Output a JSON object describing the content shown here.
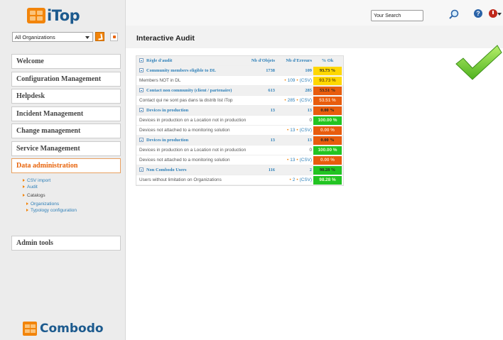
{
  "sidebar": {
    "logo_text": "iTop",
    "organization_select": "All Organizations",
    "menus": [
      {
        "label": "Welcome"
      },
      {
        "label": "Configuration Management"
      },
      {
        "label": "Helpdesk"
      },
      {
        "label": "Incident Management"
      },
      {
        "label": "Change management"
      },
      {
        "label": "Service Management"
      },
      {
        "label": "Data administration"
      },
      {
        "label": "Admin tools"
      }
    ],
    "submenu": {
      "csv_import": "CSV import",
      "audit": "Audit",
      "catalogs": "Catalogs",
      "organizations": "Organizations",
      "typology": "Typology configuration"
    },
    "footer_logo": "Combodo"
  },
  "topbar": {
    "search_value": "Your Search",
    "icons": [
      "search-icon",
      "help-icon",
      "logoff-icon"
    ]
  },
  "page": {
    "title": "Interactive Audit"
  },
  "audit": {
    "headers": [
      "Règle d'audit",
      "Nb d'Objets",
      "Nb d'Erreurs",
      "% Ok"
    ],
    "rows": [
      {
        "type": "rule",
        "label": "Community members eligible to DL",
        "objects": "1738",
        "errors": "109",
        "pct": "93.73 %",
        "color": "#ffd700"
      },
      {
        "type": "query",
        "label": "Members NOT in DL",
        "objects": "",
        "errors": "109",
        "csv": "(CSV)",
        "pct": "93.73 %",
        "color": "#ffd700"
      },
      {
        "type": "rule",
        "label": "Contact non community (client / partenaire)",
        "objects": "613",
        "errors": "285",
        "pct": "53.51 %",
        "color": "#e85c0d"
      },
      {
        "type": "query",
        "label": "Contact qui ne sont pas dans la distrib list iTop",
        "objects": "",
        "errors": "285",
        "csv": "(CSV)",
        "pct": "53.51 %",
        "color": "#e85c0d"
      },
      {
        "type": "rule",
        "label": "Devices in production",
        "objects": "13",
        "errors": "13",
        "pct": "0.00 %",
        "color": "#e85c0d"
      },
      {
        "type": "query",
        "label": "Devices in production on a Location not in production",
        "objects": "",
        "errors": "0",
        "csv": "",
        "pct": "100.00 %",
        "color": "#22c422"
      },
      {
        "type": "query",
        "label": "Devices not attached to a monitoring solution",
        "objects": "",
        "errors": "13",
        "csv": "(CSV)",
        "pct": "0.00 %",
        "color": "#e85c0d"
      },
      {
        "type": "rule",
        "label": "Devices in production",
        "objects": "13",
        "errors": "13",
        "pct": "0.00 %",
        "color": "#e85c0d"
      },
      {
        "type": "query",
        "label": "Devices in production on a Location not in production",
        "objects": "",
        "errors": "0",
        "csv": "",
        "pct": "100.00 %",
        "color": "#22c422"
      },
      {
        "type": "query",
        "label": "Devices not attached to a monitoring solution",
        "objects": "",
        "errors": "13",
        "csv": "(CSV)",
        "pct": "0.00 %",
        "color": "#e85c0d"
      },
      {
        "type": "rule",
        "label": "Non Combodo Users",
        "objects": "116",
        "errors": "2",
        "pct": "98.28 %",
        "color": "#22c422"
      },
      {
        "type": "query",
        "label": "Users without limitation on Organizations",
        "objects": "",
        "errors": "2",
        "csv": "(CSV)",
        "pct": "98.28 %",
        "color": "#22c422"
      }
    ]
  },
  "status_icon": "checkmark-icon"
}
